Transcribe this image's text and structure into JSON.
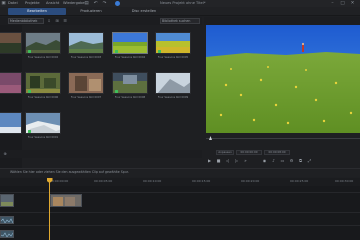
{
  "menu": {
    "items": [
      "Datei",
      "Projekte",
      "Ansicht",
      "Wiedergabe"
    ]
  },
  "window": {
    "title": "Neues Projekt ohne Titel*"
  },
  "tabs": [
    {
      "label": "Bearbeiten",
      "active": true
    },
    {
      "label": "Produzieren",
      "active": false
    },
    {
      "label": "Disc erstellen",
      "active": false
    }
  ],
  "library": {
    "filter_value": "Medienbibliothek",
    "search_placeholder": "Bibliothek suchen",
    "items": [
      {
        "label": "Four Seasons Roll 0001",
        "selected": false,
        "checked": false
      },
      {
        "label": "Four Seasons Roll 0002",
        "selected": false,
        "checked": true
      },
      {
        "label": "Four Seasons Roll 0003",
        "selected": true,
        "checked": false
      },
      {
        "label": "Four Seasons Roll 0004",
        "selected": false,
        "checked": true
      },
      {
        "label": "Four Seasons Roll 0005",
        "selected": false,
        "checked": true
      },
      {
        "label": "Four Seasons Roll 0006",
        "selected": false,
        "checked": false
      },
      {
        "label": "Four Seasons Roll 0007",
        "selected": false,
        "checked": true
      },
      {
        "label": "Four Seasons Roll 0008",
        "selected": false,
        "checked": false
      },
      {
        "label": "Four Seasons Roll 0009",
        "selected": false,
        "checked": false
      }
    ]
  },
  "preview": {
    "time_current": "00:00:00:00",
    "time_duration": "00:00:08:00",
    "zoom_label": "Anpassen"
  },
  "timeline": {
    "hint": "Wählen Sie hier oder ziehen Sie den ausgewählten Clip auf gewählte Spur.",
    "timecodes": [
      "00:00:00:00",
      "00:00:05:00",
      "00:00:10:00",
      "00:00:15:00",
      "00:00:20:00",
      "00:00:25:00",
      "00:00:30:00",
      "00:00:35:00"
    ]
  },
  "colors": {
    "accent": "#2b4c7e",
    "playhead": "#e0a930",
    "check": "#3fbf5b"
  }
}
